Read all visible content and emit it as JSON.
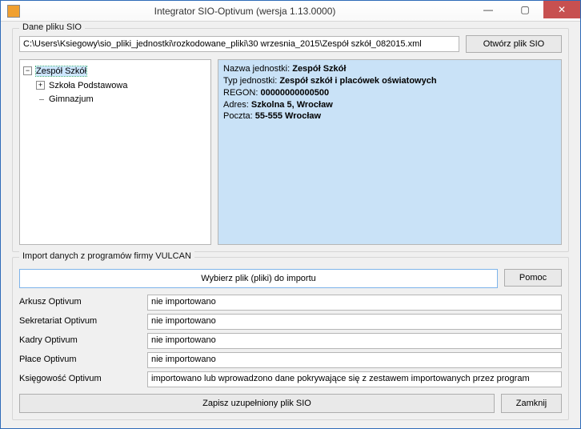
{
  "window": {
    "title": "Integrator SIO-Optivum (wersja 1.13.0000)"
  },
  "group_sio": {
    "legend": "Dane pliku SIO",
    "path": "C:\\Users\\Ksiegowy\\sio_pliki_jednostki\\rozkodowane_pliki\\30 wrzesnia_2015\\Zespół szkół_082015.xml",
    "open_btn": "Otwórz plik SIO"
  },
  "tree": {
    "root": "Zespół Szkół",
    "child1": "Szkoła Podstawowa",
    "child2": "Gimnazjum"
  },
  "info": {
    "l1_label": "Nazwa jednostki: ",
    "l1_value": "Zespół Szkół",
    "l2_label": "Typ jednostki: ",
    "l2_value": "Zespół szkół i placówek oświatowych",
    "l3_label": "REGON: ",
    "l3_value": "00000000000500",
    "l4_label": "Adres: ",
    "l4_value": "Szkolna 5, Wrocław",
    "l5_label": "Poczta: ",
    "l5_value": "55-555 Wrocław"
  },
  "group_import": {
    "legend": "Import danych z programów firmy VULCAN",
    "choose_btn": "Wybierz plik (pliki) do importu",
    "help_btn": "Pomoc",
    "labels": {
      "arkusz": "Arkusz Optivum",
      "sekretariat": "Sekretariat Optivum",
      "kadry": "Kadry Optivum",
      "place": "Płace Optivum",
      "ksiegowosc": "Księgowość Optivum"
    },
    "values": {
      "arkusz": "nie importowano",
      "sekretariat": "nie importowano",
      "kadry": "nie importowano",
      "place": "nie importowano",
      "ksiegowosc": "importowano lub wprowadzono dane pokrywające się z zestawem importowanych przez program"
    },
    "save_btn": "Zapisz uzupełniony plik SIO",
    "close_btn": "Zamknij"
  }
}
